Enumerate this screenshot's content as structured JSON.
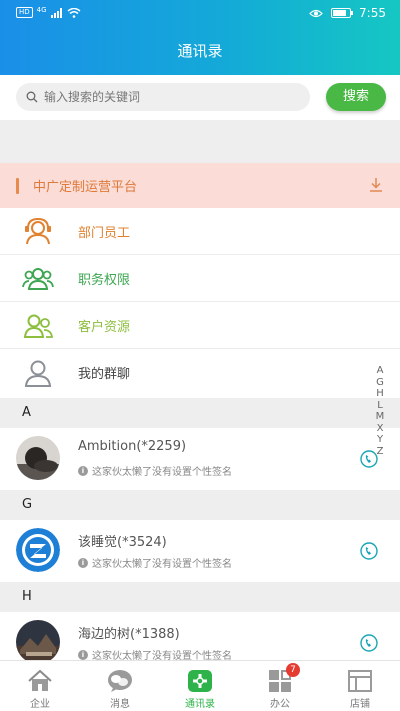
{
  "status_bar": {
    "network": "4G",
    "hd": "HD",
    "time": "7:55",
    "battery_level": 0.8
  },
  "header": {
    "title": "通讯录"
  },
  "search": {
    "placeholder": "输入搜索的关键词",
    "button_label": "搜索"
  },
  "organization": {
    "name": "中广定制运营平台",
    "color": "#de7a3a"
  },
  "menu": [
    {
      "label": "部门员工",
      "icon": "department-staff-icon",
      "color": "#e0822f"
    },
    {
      "label": "职务权限",
      "icon": "job-permission-icon",
      "color": "#3ea652"
    },
    {
      "label": "客户资源",
      "icon": "customer-resource-icon",
      "color": "#8cbf3f"
    },
    {
      "label": "我的群聊",
      "icon": "my-group-chat-icon",
      "color": "#555555"
    }
  ],
  "groups": [
    {
      "letter": "A",
      "contacts": [
        {
          "name": "Ambition(*2259)",
          "signature": "这家伙太懒了没有设置个性签名"
        }
      ]
    },
    {
      "letter": "G",
      "contacts": [
        {
          "name": "该睡觉(*3524)",
          "signature": "这家伙太懒了没有设置个性签名"
        }
      ]
    },
    {
      "letter": "H",
      "contacts": [
        {
          "name": "海边的树(*1388)",
          "signature": "这家伙太懒了没有设置个性签名"
        }
      ]
    }
  ],
  "index_letters": [
    "A",
    "G",
    "H",
    "L",
    "M",
    "X",
    "Y",
    "Z"
  ],
  "tabs": [
    {
      "label": "企业",
      "icon": "home-icon"
    },
    {
      "label": "消息",
      "icon": "chat-icon"
    },
    {
      "label": "通讯录",
      "icon": "contacts-icon",
      "active": true
    },
    {
      "label": "办公",
      "icon": "office-grid-icon",
      "badge": "7"
    },
    {
      "label": "店铺",
      "icon": "store-icon"
    }
  ],
  "colors": {
    "accent_green": "#4ab845",
    "header_start": "#1a8fe8",
    "header_end": "#15c7c3",
    "phone_icon": "#1aa6b7"
  }
}
